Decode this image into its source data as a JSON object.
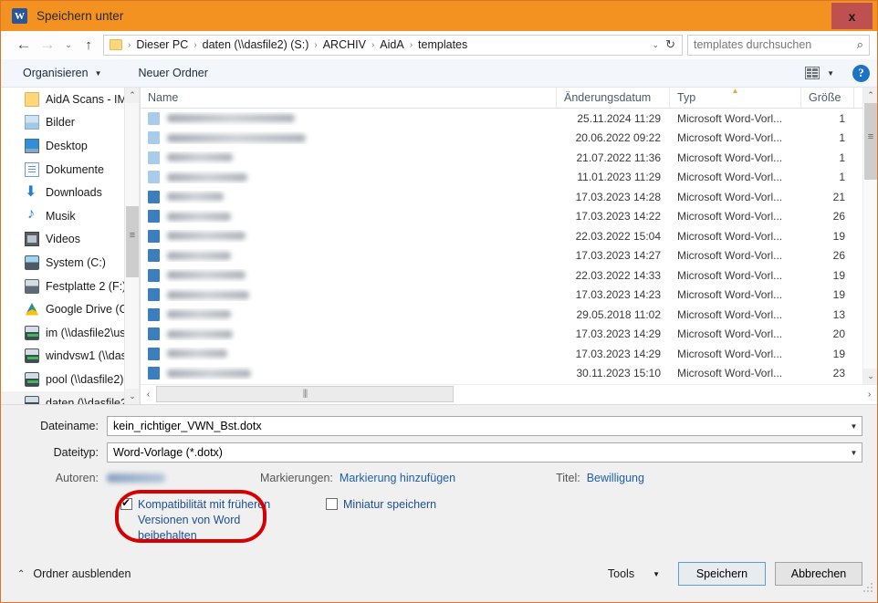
{
  "window": {
    "title": "Speichern unter",
    "app_icon": "W",
    "close_label": "x",
    "titlebar_color": "#f39121"
  },
  "nav": {
    "back_icon": "←",
    "forward_icon": "→",
    "recent_icon": "⌄",
    "up_icon": "↑",
    "breadcrumb": [
      "Dieser PC",
      "daten (\\\\dasfile2) (S:)",
      "ARCHIV",
      "AidA",
      "templates"
    ],
    "breadcrumb_separator": "›",
    "dropdown_icon": "⌄",
    "refresh_icon": "↻",
    "search_placeholder": "templates durchsuchen",
    "search_value": "",
    "search_icon": "⌕"
  },
  "command_bar": {
    "organize_label": "Organisieren",
    "new_folder_label": "Neuer Ordner",
    "dropdown_icon": "▼",
    "help_label": "?"
  },
  "sidebar": {
    "items": [
      {
        "label": "AidA Scans - IM",
        "icon": "folder-icon",
        "icon_class": "ic-folder"
      },
      {
        "label": "Bilder",
        "icon": "pictures-icon",
        "icon_class": "ic-pics"
      },
      {
        "label": "Desktop",
        "icon": "desktop-icon",
        "icon_class": "ic-desktop"
      },
      {
        "label": "Dokumente",
        "icon": "documents-icon",
        "icon_class": "ic-docs"
      },
      {
        "label": "Downloads",
        "icon": "downloads-icon",
        "icon_class": "ic-dl"
      },
      {
        "label": "Musik",
        "icon": "music-icon",
        "icon_class": "ic-music"
      },
      {
        "label": "Videos",
        "icon": "videos-icon",
        "icon_class": "ic-video"
      },
      {
        "label": "System (C:)",
        "icon": "system-drive-icon",
        "icon_class": "ic-sysdrive"
      },
      {
        "label": "Festplatte 2 (F:)",
        "icon": "drive-icon",
        "icon_class": "ic-drive"
      },
      {
        "label": "Google Drive (G:",
        "icon": "google-drive-icon",
        "icon_class": "ic-gdrive"
      },
      {
        "label": "im (\\\\dasfile2\\us",
        "icon": "network-drive-icon",
        "icon_class": "ic-net"
      },
      {
        "label": "windvsw1 (\\\\das",
        "icon": "network-drive-icon",
        "icon_class": "ic-net"
      },
      {
        "label": "pool (\\\\dasfile2)",
        "icon": "network-drive-icon",
        "icon_class": "ic-net"
      },
      {
        "label": "daten (\\\\dasfile2",
        "icon": "network-drive-icon",
        "icon_class": "ic-net",
        "selected": true
      }
    ],
    "scroll_up_icon": "⌃",
    "scroll_down_icon": "⌄"
  },
  "file_list": {
    "columns": [
      "Name",
      "Änderungsdatum",
      "Typ",
      "Größe"
    ],
    "sorted_column": "Typ",
    "sort_direction_icon": "▲",
    "rows": [
      {
        "name": "",
        "redacted": true,
        "icon_shade": "light",
        "name_width": 140,
        "date": "25.11.2024 11:29",
        "type": "Microsoft Word-Vorl...",
        "size": "1"
      },
      {
        "name": "",
        "redacted": true,
        "icon_shade": "light",
        "name_width": 152,
        "date": "20.06.2022 09:22",
        "type": "Microsoft Word-Vorl...",
        "size": "1"
      },
      {
        "name": "",
        "redacted": true,
        "icon_shade": "light",
        "name_width": 72,
        "date": "21.07.2022 11:36",
        "type": "Microsoft Word-Vorl...",
        "size": "1"
      },
      {
        "name": "",
        "redacted": true,
        "icon_shade": "light",
        "name_width": 88,
        "date": "11.01.2023 11:29",
        "type": "Microsoft Word-Vorl...",
        "size": "1"
      },
      {
        "name": "",
        "redacted": true,
        "icon_shade": "dark",
        "name_width": 62,
        "date": "17.03.2023 14:28",
        "type": "Microsoft Word-Vorl...",
        "size": "21"
      },
      {
        "name": "",
        "redacted": true,
        "icon_shade": "dark",
        "name_width": 70,
        "date": "17.03.2023 14:22",
        "type": "Microsoft Word-Vorl...",
        "size": "26"
      },
      {
        "name": "",
        "redacted": true,
        "icon_shade": "dark",
        "name_width": 86,
        "date": "22.03.2022 15:04",
        "type": "Microsoft Word-Vorl...",
        "size": "19"
      },
      {
        "name": "",
        "redacted": true,
        "icon_shade": "dark",
        "name_width": 70,
        "date": "17.03.2023 14:27",
        "type": "Microsoft Word-Vorl...",
        "size": "26"
      },
      {
        "name": "",
        "redacted": true,
        "icon_shade": "dark",
        "name_width": 86,
        "date": "22.03.2022 14:33",
        "type": "Microsoft Word-Vorl...",
        "size": "19"
      },
      {
        "name": "",
        "redacted": true,
        "icon_shade": "dark",
        "name_width": 90,
        "date": "17.03.2023 14:23",
        "type": "Microsoft Word-Vorl...",
        "size": "19"
      },
      {
        "name": "",
        "redacted": true,
        "icon_shade": "dark",
        "name_width": 70,
        "date": "29.05.2018 11:02",
        "type": "Microsoft Word-Vorl...",
        "size": "13"
      },
      {
        "name": "",
        "redacted": true,
        "icon_shade": "dark",
        "name_width": 72,
        "date": "17.03.2023 14:29",
        "type": "Microsoft Word-Vorl...",
        "size": "20"
      },
      {
        "name": "",
        "redacted": true,
        "icon_shade": "dark",
        "name_width": 66,
        "date": "17.03.2023 14:29",
        "type": "Microsoft Word-Vorl...",
        "size": "19"
      },
      {
        "name": "",
        "redacted": true,
        "icon_shade": "dark",
        "name_width": 92,
        "date": "30.11.2023 15:10",
        "type": "Microsoft Word-Vorl...",
        "size": "23"
      }
    ],
    "hscroll_left_icon": "‹",
    "hscroll_right_icon": "›"
  },
  "form": {
    "filename_label": "Dateiname:",
    "filename_value": "kein_richtiger_VWN_Bst.dotx",
    "filetype_label": "Dateityp:",
    "filetype_value": "Word-Vorlage (*.dotx)",
    "dropdown_icon": "▼",
    "authors_label": "Autoren:",
    "authors_value": "",
    "authors_redacted": true,
    "tags_label": "Markierungen:",
    "tags_link": "Markierung hinzufügen",
    "title_label": "Titel:",
    "title_link": "Bewilligung",
    "compat_checkbox_label": "Kompatibilität mit früheren Versionen von Word beibehalten",
    "compat_checked": true,
    "thumbnail_checkbox_label": "Miniatur speichern",
    "thumbnail_checked": false,
    "annotation_color": "#d60000"
  },
  "footer": {
    "hide_folders_label": "Ordner ausblenden",
    "hide_folders_icon": "⌃",
    "tools_label": "Tools",
    "tools_icon": "▼",
    "save_label": "Speichern",
    "cancel_label": "Abbrechen"
  }
}
